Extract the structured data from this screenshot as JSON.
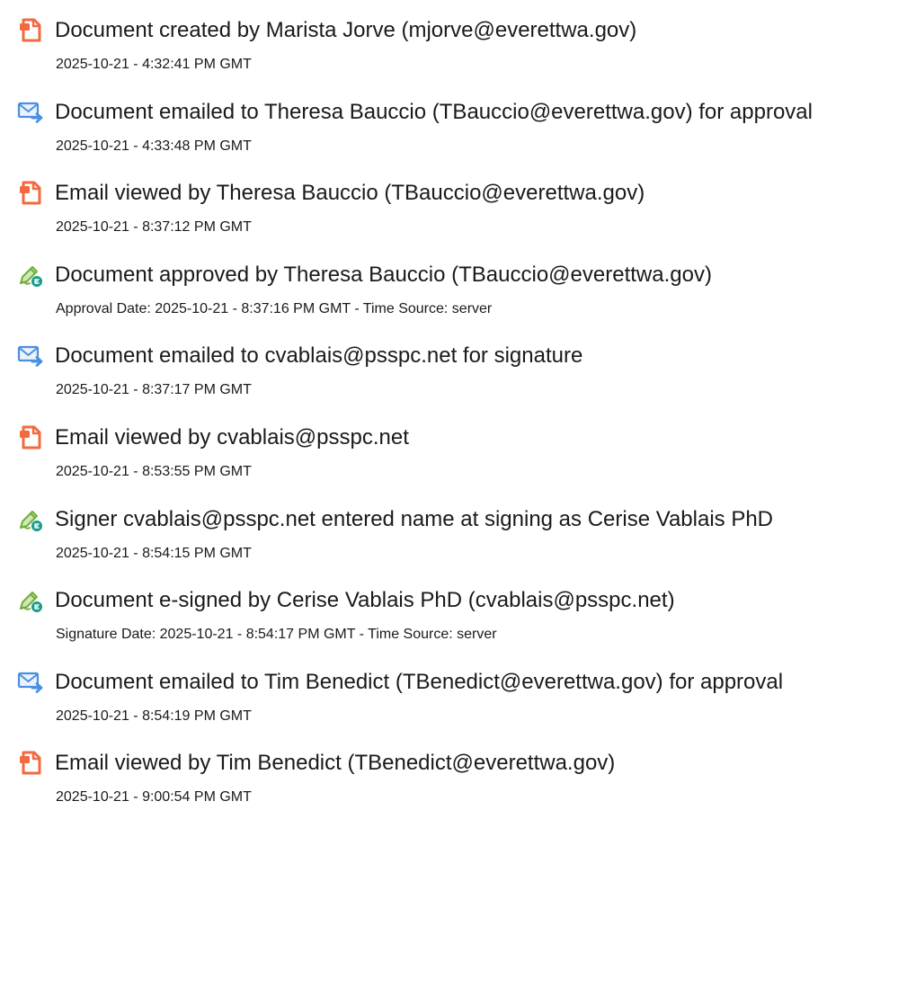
{
  "colors": {
    "doc_icon": "#f26a3f",
    "email_icon": "#4a8fe0",
    "sign_icon": "#6fae3a",
    "sign_badge": "#1a9c8a",
    "text": "#1a1a1a"
  },
  "entries": [
    {
      "icon": "document-icon",
      "title": "Document created by Marista Jorve (mjorve@everettwa.gov)",
      "sub": "2025-10-21 - 4:32:41 PM GMT"
    },
    {
      "icon": "email-icon",
      "title": "Document emailed to Theresa Bauccio (TBauccio@everettwa.gov) for approval",
      "sub": "2025-10-21 - 4:33:48 PM GMT"
    },
    {
      "icon": "document-icon",
      "title": "Email viewed by Theresa Bauccio (TBauccio@everettwa.gov)",
      "sub": "2025-10-21 - 8:37:12 PM GMT"
    },
    {
      "icon": "signature-pen-icon",
      "title": "Document approved by Theresa Bauccio (TBauccio@everettwa.gov)",
      "sub": "Approval Date: 2025-10-21 - 8:37:16 PM GMT - Time Source: server"
    },
    {
      "icon": "email-icon",
      "title": "Document emailed to cvablais@psspc.net for signature",
      "sub": "2025-10-21 - 8:37:17 PM GMT"
    },
    {
      "icon": "document-icon",
      "title": "Email viewed by cvablais@psspc.net",
      "sub": "2025-10-21 - 8:53:55 PM GMT"
    },
    {
      "icon": "signature-pen-icon",
      "title": "Signer cvablais@psspc.net entered name at signing as Cerise Vablais PhD",
      "sub": "2025-10-21 - 8:54:15 PM GMT"
    },
    {
      "icon": "signature-pen-icon",
      "title": "Document e-signed by Cerise Vablais PhD (cvablais@psspc.net)",
      "sub": "Signature Date: 2025-10-21 - 8:54:17 PM GMT - Time Source: server"
    },
    {
      "icon": "email-icon",
      "title": "Document emailed to Tim Benedict (TBenedict@everettwa.gov) for approval",
      "sub": "2025-10-21 - 8:54:19 PM GMT"
    },
    {
      "icon": "document-icon",
      "title": "Email viewed by Tim Benedict (TBenedict@everettwa.gov)",
      "sub": "2025-10-21 - 9:00:54 PM GMT"
    }
  ]
}
